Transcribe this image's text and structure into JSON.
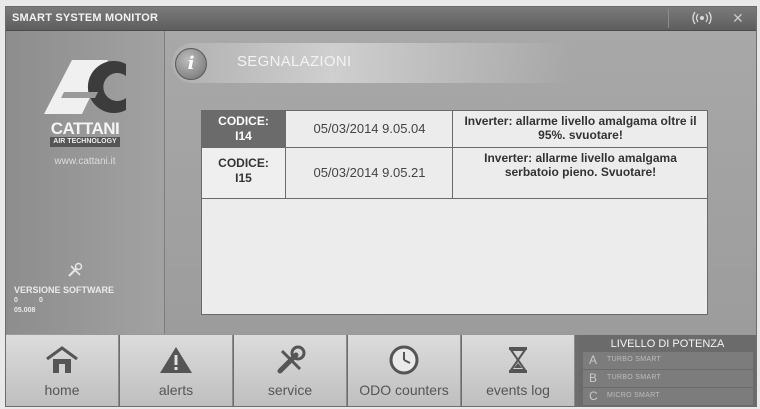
{
  "app": {
    "title": "SMART SYSTEM MONITOR"
  },
  "titlebar": {
    "signal_icon": "wireless-signal-icon",
    "close_icon": "close-icon"
  },
  "sidebar": {
    "brand": "CATTANI",
    "brand_sub": "AIR TECHNOLOGY",
    "website": "www.cattani.it",
    "software_label": "VERSIONE SOFTWARE",
    "software_v1": "0",
    "software_v2": "0",
    "software_v3": "05.008"
  },
  "section": {
    "title": "SEGNALAZIONI",
    "icon": "info-icon"
  },
  "alerts": [
    {
      "code": "CODICE:\nI14",
      "datetime": "05/03/2014 9.05.04",
      "message": "Inverter: allarme livello amalgama oltre il 95%. svuotare!",
      "selected": true
    },
    {
      "code": "CODICE:\nI15",
      "datetime": "05/03/2014 9.05.21",
      "message": "Inverter: allarme livello amalgama serbatoio pieno. Svuotare!",
      "selected": false
    }
  ],
  "nav": [
    {
      "label": "home",
      "icon": "home-icon"
    },
    {
      "label": "alerts",
      "icon": "warning-icon"
    },
    {
      "label": "service",
      "icon": "tools-icon"
    },
    {
      "label": "ODO counters",
      "icon": "clock-icon"
    },
    {
      "label": "events log",
      "icon": "hourglass-icon"
    }
  ],
  "power": {
    "title": "LIVELLO DI POTENZA",
    "options": [
      {
        "letter": "A",
        "name": "TURBO SMART"
      },
      {
        "letter": "B",
        "name": "TURBO SMART"
      },
      {
        "letter": "C",
        "name": "MICRO SMART"
      }
    ]
  },
  "colors": {
    "frame": "#9a9a9a",
    "selected_row": "#6b6b6b",
    "panel_bg": "#ececec"
  }
}
